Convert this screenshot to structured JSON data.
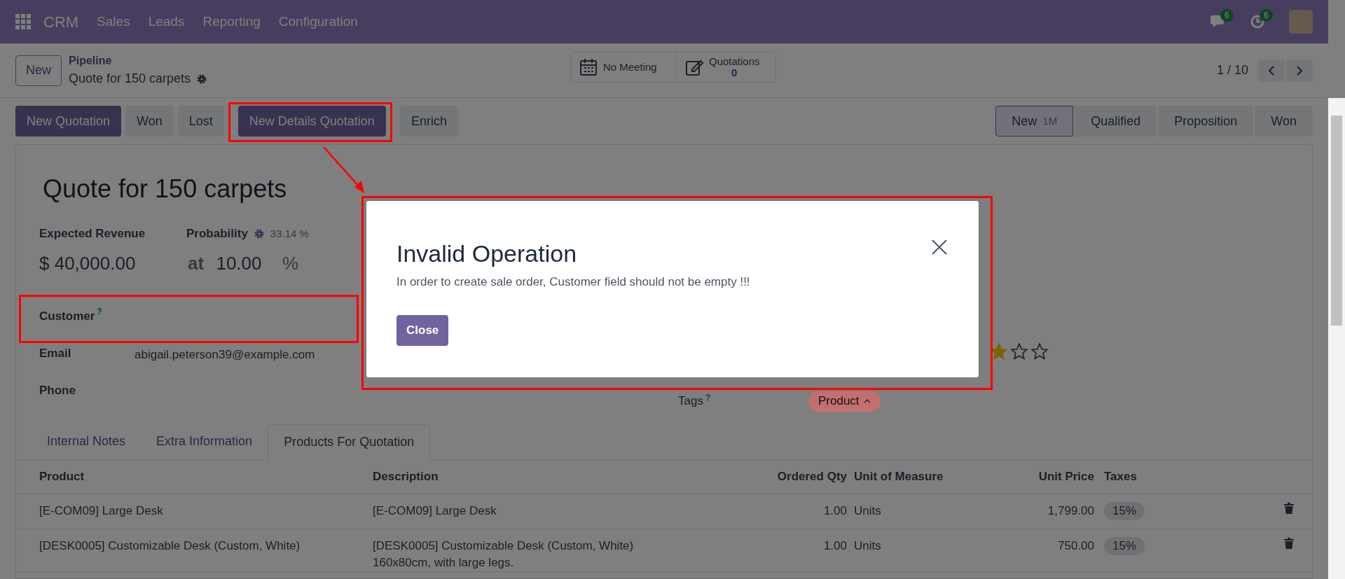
{
  "navbar": {
    "app": "CRM",
    "menu": [
      "Sales",
      "Leads",
      "Reporting",
      "Configuration"
    ],
    "indicators": [
      {
        "kind": "chat",
        "count": "6"
      },
      {
        "kind": "activity",
        "count": "6"
      }
    ]
  },
  "control_panel": {
    "new_button": "New",
    "breadcrumb": "Pipeline",
    "record_title": "Quote for 150 carpets",
    "smart_buttons": [
      {
        "kind": "calendar",
        "label": "No Meeting"
      },
      {
        "kind": "edit",
        "label": "Quotations",
        "value": "0"
      }
    ],
    "pager": "1 / 10"
  },
  "actions": [
    {
      "label": "New Quotation",
      "primary": true
    },
    {
      "label": "Won",
      "primary": false
    },
    {
      "label": "Lost",
      "primary": false
    },
    {
      "label": "New Details Quotation",
      "primary": true
    },
    {
      "label": "Enrich",
      "primary": false
    }
  ],
  "stages": [
    {
      "label": "New",
      "count": "1M",
      "selected": true
    },
    {
      "label": "Qualified",
      "selected": false
    },
    {
      "label": "Proposition",
      "selected": false
    },
    {
      "label": "Won",
      "selected": false
    }
  ],
  "form": {
    "title": "Quote for 150 carpets",
    "revenue_label": "Expected Revenue",
    "probability_label": "Probability",
    "auto_probability": "33.14 %",
    "revenue": "$ 40,000.00",
    "at": "at",
    "probability": "10.00",
    "percent": "%",
    "fields": [
      {
        "label": "Customer",
        "help": "?"
      },
      {
        "label": "Email",
        "value": "abigail.peterson39@example.com"
      },
      {
        "label": "Phone"
      }
    ],
    "priority": {
      "stars": 1
    },
    "tags_label": "Tags",
    "tags_help": "?",
    "tags": [
      {
        "label": "Product",
        "color": "#c46f6f"
      }
    ]
  },
  "tabs": [
    {
      "label": "Internal Notes",
      "selected": false
    },
    {
      "label": "Extra Information",
      "selected": false
    },
    {
      "label": "Products For Quotation",
      "selected": true
    }
  ],
  "table": {
    "columns": [
      "Product",
      "Description",
      "Ordered Qty",
      "Unit of Measure",
      "Unit Price",
      "Taxes"
    ],
    "rows": [
      {
        "product": "[E-COM09] Large Desk",
        "description": [
          "[E-COM09] Large Desk"
        ],
        "qty": "1.00",
        "uom": "Units",
        "price": "1,799.00",
        "tax": "15%"
      },
      {
        "product": "[DESK0005] Customizable Desk (Custom, White)",
        "description": [
          "[DESK0005] Customizable Desk (Custom, White)",
          "160x80cm, with large legs."
        ],
        "qty": "1.00",
        "uom": "Units",
        "price": "750.00",
        "tax": "15%"
      }
    ]
  },
  "dialog": {
    "title": "Invalid Operation",
    "message": "In order to create sale order, Customer field should not be empty !!!",
    "close_button": "Close"
  }
}
